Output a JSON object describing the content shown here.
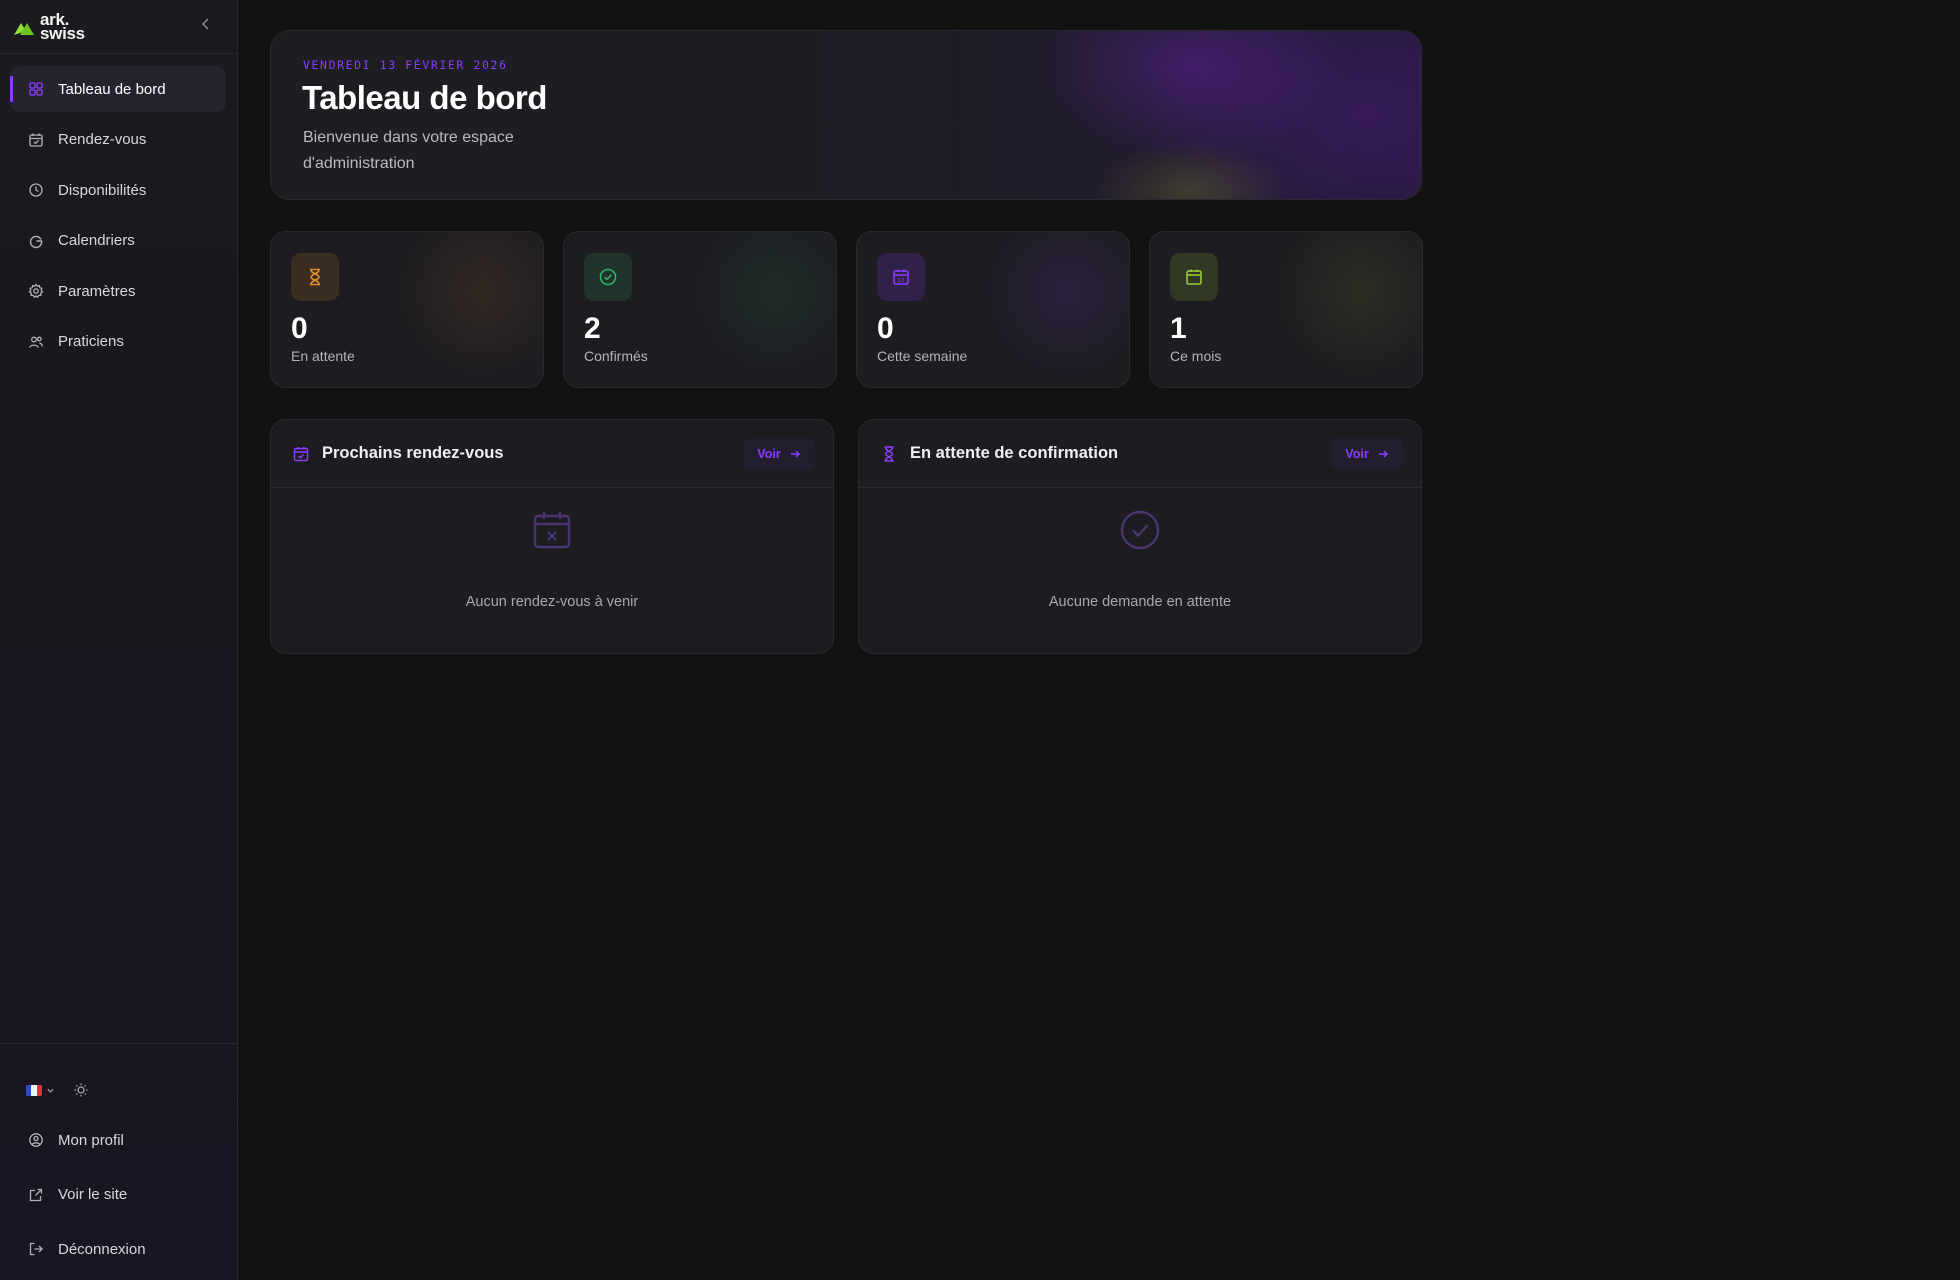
{
  "brand": {
    "line1": "ark.",
    "line2": "swiss"
  },
  "sidebar": {
    "items": [
      {
        "label": "Tableau de bord",
        "icon": "grid-icon",
        "active": true
      },
      {
        "label": "Rendez-vous",
        "icon": "calendar-check-icon"
      },
      {
        "label": "Disponibilités",
        "icon": "clock-icon"
      },
      {
        "label": "Calendriers",
        "icon": "google-icon"
      },
      {
        "label": "Paramètres",
        "icon": "gear-icon"
      },
      {
        "label": "Praticiens",
        "icon": "users-icon"
      }
    ],
    "bottom": [
      {
        "label": "Mon profil",
        "icon": "user-circle-icon"
      },
      {
        "label": "Voir le site",
        "icon": "external-link-icon"
      },
      {
        "label": "Déconnexion",
        "icon": "logout-icon"
      }
    ]
  },
  "hero": {
    "date": "VENDREDI 13 FÉVRIER 2026",
    "title": "Tableau de bord",
    "subtitle": "Bienvenue dans votre espace d'administration"
  },
  "stats": [
    {
      "value": "0",
      "label": "En attente",
      "icon": "hourglass-icon",
      "color": "#e08a2c"
    },
    {
      "value": "2",
      "label": "Confirmés",
      "icon": "check-circle-icon",
      "color": "#2fb36a"
    },
    {
      "value": "0",
      "label": "Cette semaine",
      "icon": "calendar-week-icon",
      "color": "#8b3dff"
    },
    {
      "value": "1",
      "label": "Ce mois",
      "icon": "calendar-icon",
      "color": "#9ccc3a"
    }
  ],
  "panels": [
    {
      "title": "Prochains rendez-vous",
      "button": "Voir",
      "empty": "Aucun rendez-vous à venir"
    },
    {
      "title": "En attente de confirmation",
      "button": "Voir",
      "empty": "Aucune demande en attente"
    }
  ],
  "colors": {
    "accent": "#8b3dff",
    "background": "#121212",
    "card": "#1d1c21"
  }
}
